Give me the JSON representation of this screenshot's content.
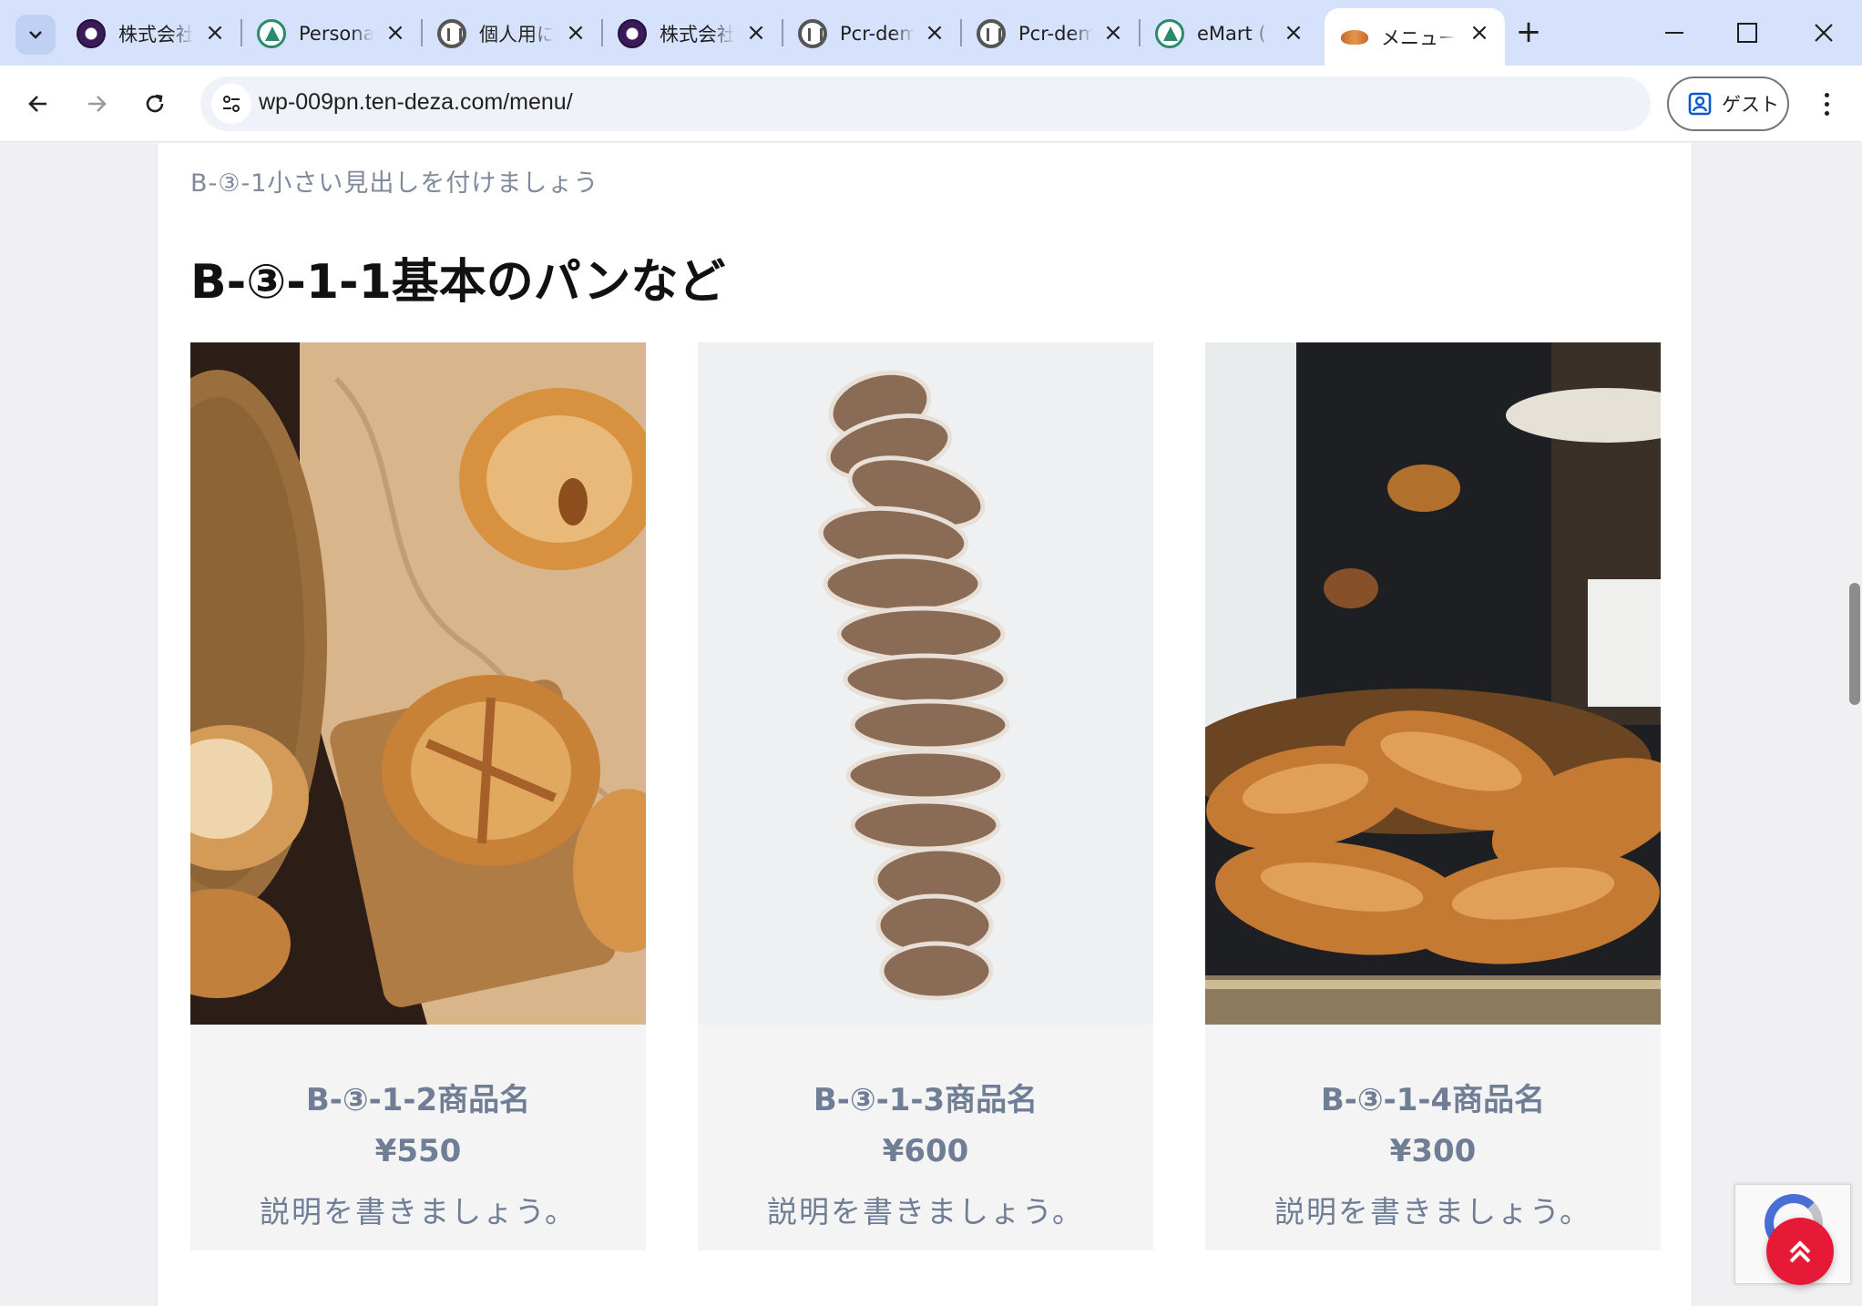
{
  "tabs": [
    {
      "label": "株式会社",
      "favicon": "purple-logo-icon"
    },
    {
      "label": "Personal",
      "favicon": "green-a-icon"
    },
    {
      "label": "個人用に",
      "favicon": "wordpress-icon"
    },
    {
      "label": "株式会社",
      "favicon": "purple-logo-icon"
    },
    {
      "label": "Pcr-demo",
      "favicon": "wordpress-icon"
    },
    {
      "label": "Pcr-demo",
      "favicon": "wordpress-icon"
    },
    {
      "label": "eMart (",
      "favicon": "green-a-icon"
    },
    {
      "label": "メニュー",
      "favicon": "croissant-icon",
      "active": true
    }
  ],
  "toolbar": {
    "url": "wp-009pn.ten-deza.com/menu/",
    "guest_label": "ゲスト"
  },
  "page": {
    "subheading": "B-③-1小さい見出しを付けましょう",
    "heading": "B-③-1-1基本のパンなど",
    "products": [
      {
        "name": "B-③-1-2商品名",
        "price": "¥550",
        "description": "説明を書きましょう。"
      },
      {
        "name": "B-③-1-3商品名",
        "price": "¥600",
        "description": "説明を書きましょう。"
      },
      {
        "name": "B-③-1-4商品名",
        "price": "¥300",
        "description": "説明を書きましょう。"
      }
    ]
  },
  "colors": {
    "tabstrip": "#d6e2fb",
    "accent_red": "#e61a36",
    "product_text": "#6f7e95"
  }
}
